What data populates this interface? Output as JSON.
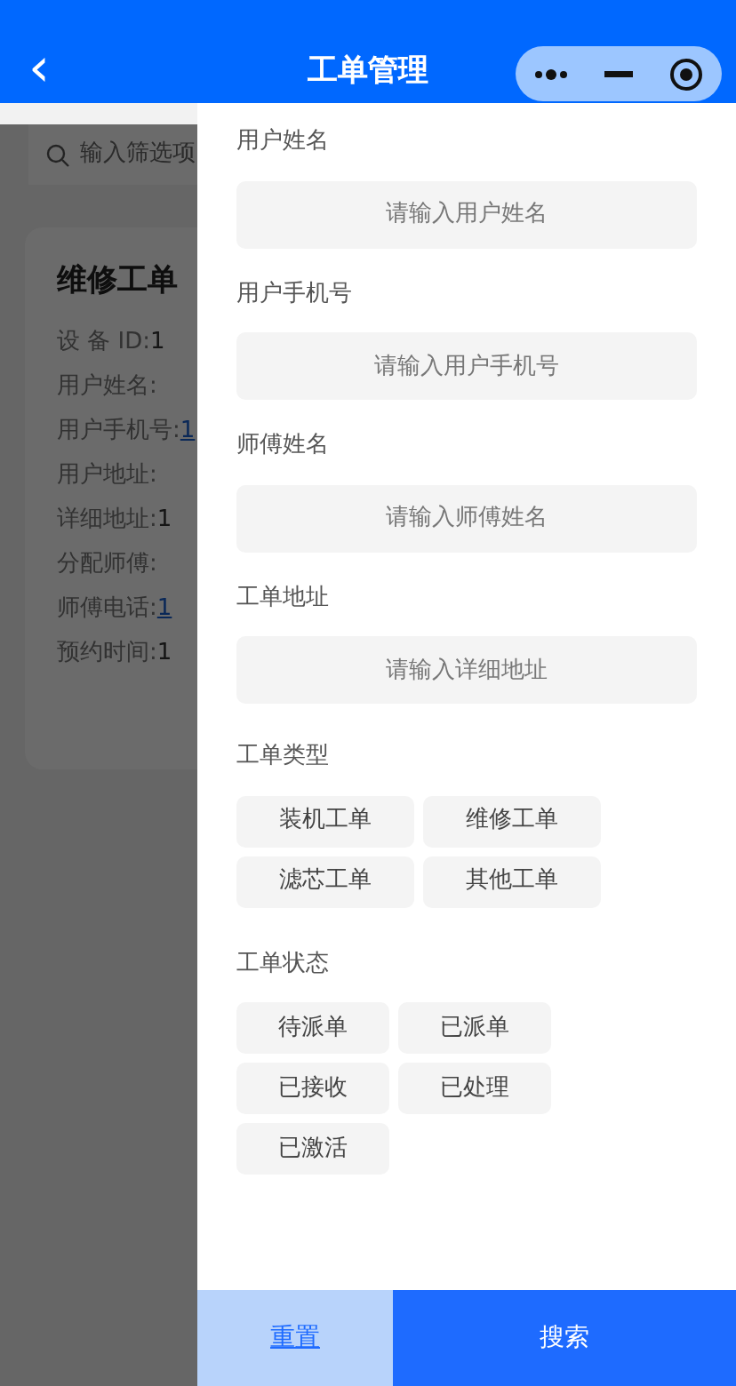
{
  "header": {
    "back": "‹",
    "title": "工单管理"
  },
  "background": {
    "search": {
      "placeholder": "输入筛选项"
    },
    "card": {
      "title": "维修工单",
      "fields": [
        {
          "label": "设 备 ID:",
          "value": "1",
          "link": false
        },
        {
          "label": "用户姓名:"
        },
        {
          "label": "用户手机号:",
          "value": "1",
          "link": true
        },
        {
          "label": "用户地址:"
        },
        {
          "label": "详细地址:",
          "value": "1",
          "link": false
        },
        {
          "label": "分配师傅:"
        },
        {
          "label": "师傅电话:",
          "value": "1",
          "link": true
        },
        {
          "label": "预约时间:",
          "value": "1",
          "link": false
        }
      ]
    }
  },
  "filter": {
    "fields": [
      {
        "label": "用户姓名",
        "placeholder": "请输入用户姓名"
      },
      {
        "label": "用户手机号",
        "placeholder": "请输入用户手机号"
      },
      {
        "label": "师傅姓名",
        "placeholder": "请输入师傅姓名"
      },
      {
        "label": "工单地址",
        "placeholder": "请输入详细地址"
      }
    ],
    "groups": [
      {
        "label": "工单类型",
        "wide": true,
        "options": [
          {
            "text": "装机工单",
            "selected": false
          },
          {
            "text": "维修工单",
            "selected": false
          },
          {
            "text": "滤芯工单",
            "selected": false
          },
          {
            "text": "其他工单",
            "selected": false
          }
        ]
      },
      {
        "label": "工单状态",
        "wide": false,
        "options": [
          {
            "text": "待派单",
            "selected": false
          },
          {
            "text": "已派单",
            "selected": false
          },
          {
            "text": "已接收",
            "selected": false
          },
          {
            "text": "已处理",
            "selected": false
          },
          {
            "text": "已激活",
            "selected": false
          }
        ]
      }
    ],
    "buttons": [
      {
        "text": "重置",
        "kind": "secondary"
      },
      {
        "text": "搜索",
        "kind": "primary"
      }
    ]
  }
}
